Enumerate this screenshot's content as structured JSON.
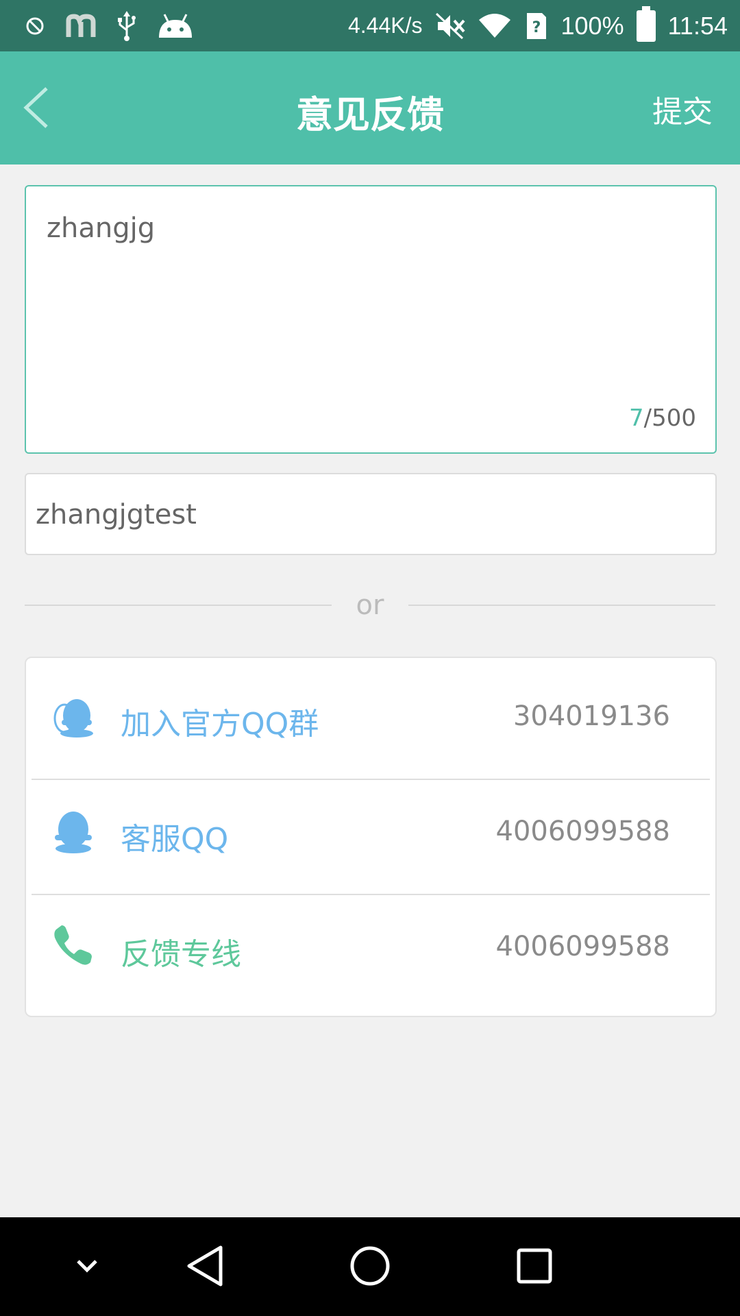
{
  "status_bar": {
    "net_speed": "4.44K/s",
    "battery": "100%",
    "time": "11:54",
    "sim_label": "?"
  },
  "header": {
    "title": "意见反馈",
    "submit_label": "提交"
  },
  "feedback": {
    "text": "zhangjg",
    "count": "7",
    "max": "/500"
  },
  "contact": {
    "value": "zhangjgtest"
  },
  "divider": {
    "label": "or"
  },
  "contacts": [
    {
      "label": "加入官方QQ群",
      "value": "304019136",
      "icon": "qq-group-icon"
    },
    {
      "label": "客服QQ",
      "value": "4006099588",
      "icon": "qq-icon"
    },
    {
      "label": "反馈专线",
      "value": "4006099588",
      "icon": "phone-icon"
    }
  ],
  "colors": {
    "header": "#4fbfa9",
    "status_bar": "#2f7565",
    "qq_blue": "#6cb6ec",
    "phone_green": "#5ec89b"
  }
}
